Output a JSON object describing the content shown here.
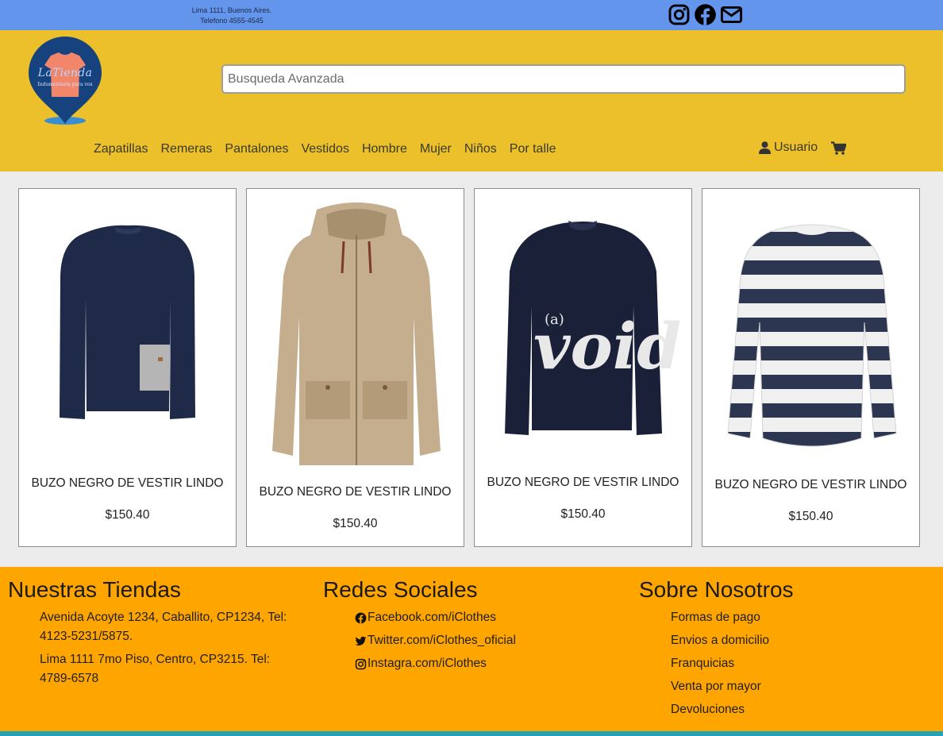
{
  "topbar": {
    "address": "Lima 1111, Buenos Aires.",
    "phone": "Telefono 4555-4545",
    "social_icons": [
      "instagram-icon",
      "facebook-icon",
      "mail-icon"
    ],
    "background": "#6495ed"
  },
  "header": {
    "logo_text": "LaTienda",
    "logo_subtext": "Indumentaria para vos",
    "search_placeholder": "Busqueda Avanzada",
    "background": "#ecc02a",
    "nav": [
      "Zapatillas",
      "Remeras",
      "Pantalones",
      "Vestidos",
      "Hombre",
      "Mujer",
      "Niños",
      "Por talle"
    ],
    "user_label": "Usuario",
    "cart_icon": "cart-icon"
  },
  "products": [
    {
      "name": "BUZO NEGRO DE VESTIR LINDO",
      "price": "$150.40",
      "image": "navy-sweater"
    },
    {
      "name": "BUZO NEGRO DE VESTIR LINDO",
      "price": "$150.40",
      "image": "beige-parka"
    },
    {
      "name": "BUZO NEGRO DE VESTIR LINDO",
      "price": "$150.40",
      "image": "void-sweatshirt"
    },
    {
      "name": "BUZO NEGRO DE VESTIR LINDO",
      "price": "$150.40",
      "image": "striped-sweater"
    }
  ],
  "footer": {
    "background": "#ffa500",
    "stores_title": "Nuestras Tiendas",
    "stores": [
      "Avenida Acoyte 1234, Caballito, CP1234, Tel: 4123-5231/5875.",
      "Lima 1111 7mo Piso, Centro, CP3215. Tel: 4789-6578"
    ],
    "social_title": "Redes Sociales",
    "social": [
      {
        "label": "Facebook.com/iClothes",
        "icon": "facebook-icon"
      },
      {
        "label": "Twitter.com/iClothes_oficial",
        "icon": "twitter-icon"
      },
      {
        "label": "Instagra.com/iClothes",
        "icon": "instagram-icon"
      }
    ],
    "about_title": "Sobre Nosotros",
    "about": [
      "Formas de pago",
      "Envios a domicilio",
      "Franquicias",
      "Venta por mayor",
      "Devoluciones"
    ]
  }
}
